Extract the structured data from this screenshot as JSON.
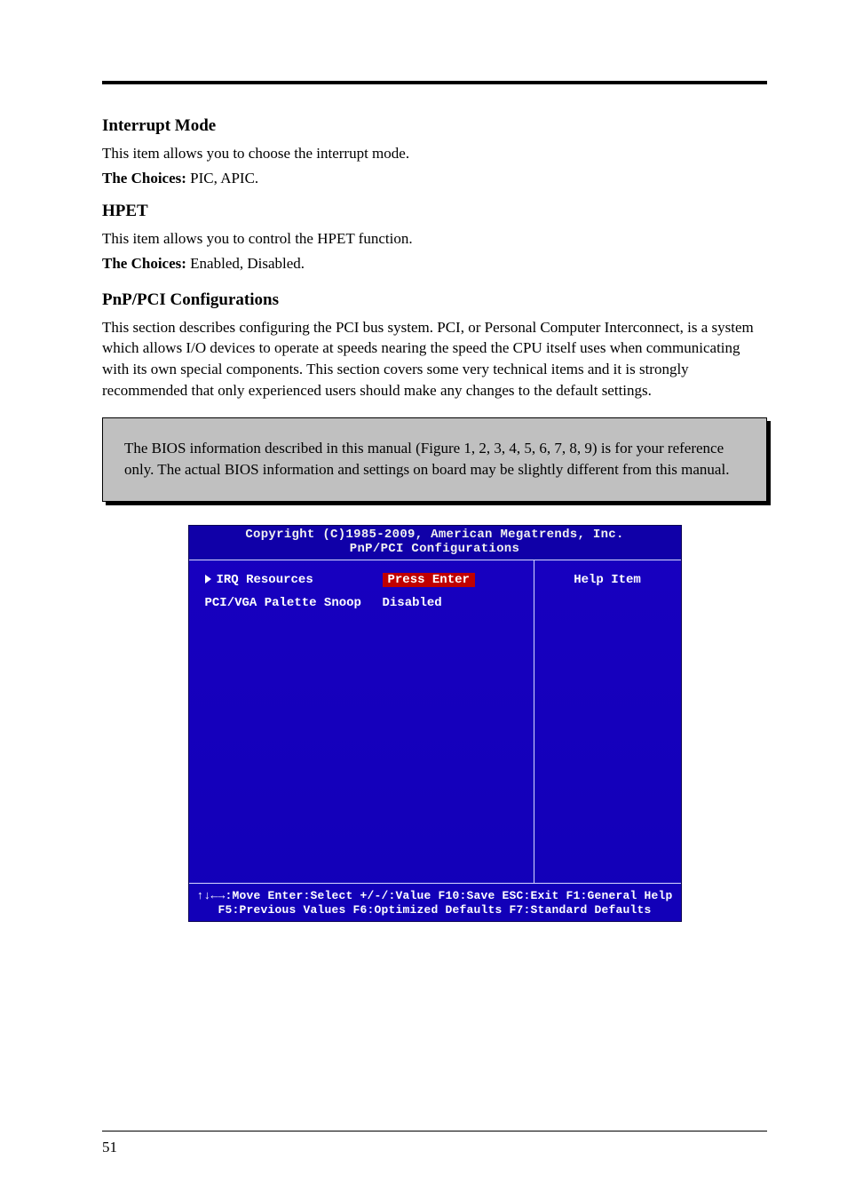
{
  "section1": {
    "title": "Interrupt Mode",
    "body": "This item allows you to choose the interrupt mode.",
    "choices_label": "The Choices:",
    "choices": "PIC, APIC."
  },
  "section2": {
    "title": "HPET",
    "body": "This item allows you to control the HPET function.",
    "choices_label": "The Choices:",
    "choices": "Enabled, Disabled."
  },
  "section3": {
    "title": "PnP/PCI Configurations",
    "body": "This section describes configuring the PCI bus system. PCI, or Personal Computer Interconnect, is a system which allows I/O devices to operate at speeds nearing the speed the CPU itself uses when communicating with its own special components. This section covers some very technical items and it is strongly recommended that only experienced users should make any changes to the default settings."
  },
  "note": "The BIOS information described in this manual (Figure 1, 2, 3, 4, 5, 6, 7, 8, 9) is for your reference only. The actual BIOS information and settings on board may be slightly different from this manual.",
  "bios": {
    "header_line1": "Copyright (C)1985-2009, American Megatrends, Inc.",
    "header_line2": "PnP/PCI Configurations",
    "rows": [
      {
        "label": "IRQ Resources",
        "value": "Press Enter",
        "selected": true,
        "arrow": true
      },
      {
        "label": "PCI/VGA Palette Snoop",
        "value": "Disabled",
        "selected": false,
        "arrow": false
      }
    ],
    "help_title": "Help Item",
    "footer_line1": "↑↓←→:Move  Enter:Select  +/-/:Value  F10:Save  ESC:Exit  F1:General Help",
    "footer_line2": "F5:Previous Values    F6:Optimized Defaults    F7:Standard Defaults"
  },
  "page_number": "51"
}
